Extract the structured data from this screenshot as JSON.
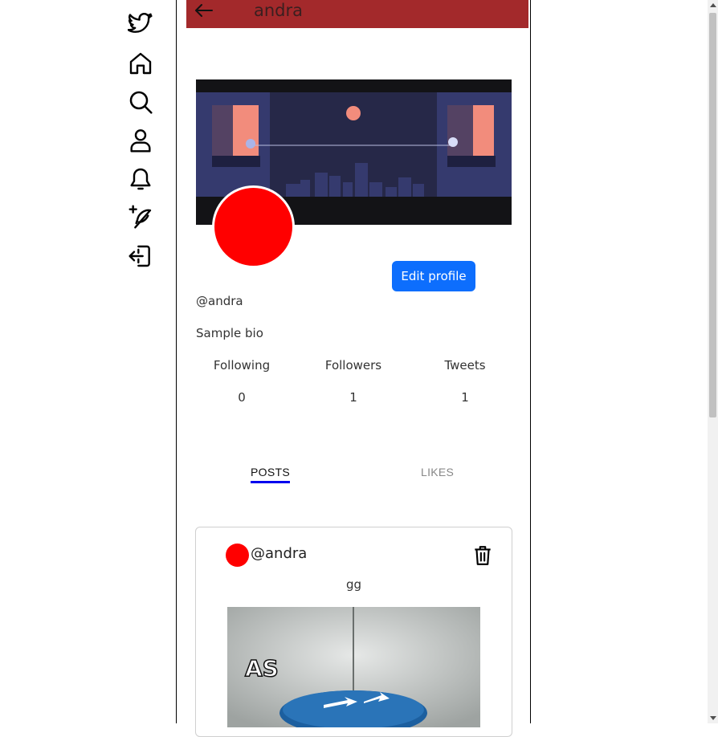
{
  "sidebar": {
    "items": [
      {
        "icon": "bird-logo-icon"
      },
      {
        "icon": "home-icon"
      },
      {
        "icon": "search-icon"
      },
      {
        "icon": "profile-icon"
      },
      {
        "icon": "bell-icon"
      },
      {
        "icon": "compose-feather-icon"
      },
      {
        "icon": "logout-icon"
      }
    ]
  },
  "header": {
    "title": "andra",
    "back_icon": "arrow-left-icon",
    "color": "#a3292b"
  },
  "profile": {
    "edit_label": "Edit profile",
    "handle": "@andra",
    "bio": "Sample bio",
    "avatar_color": "#ff0000",
    "stats": [
      {
        "label": "Following",
        "value": "0"
      },
      {
        "label": "Followers",
        "value": "1"
      },
      {
        "label": "Tweets",
        "value": "1"
      }
    ]
  },
  "tabs": {
    "posts": "POSTS",
    "likes": "LIKES",
    "active": "posts"
  },
  "post": {
    "handle": "@andra",
    "text": "gg",
    "image_caption": "AS"
  }
}
